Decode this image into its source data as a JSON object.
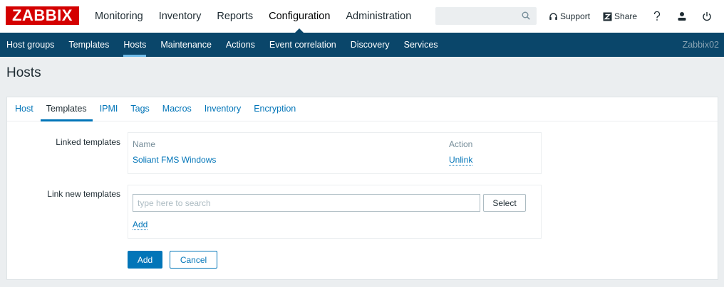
{
  "brand": {
    "logo_text": "ZABBIX",
    "color": "#d40000"
  },
  "main_menu": [
    {
      "label": "Monitoring"
    },
    {
      "label": "Inventory"
    },
    {
      "label": "Reports"
    },
    {
      "label": "Configuration",
      "active": true
    },
    {
      "label": "Administration"
    }
  ],
  "search": {
    "placeholder": "",
    "icon": "search-icon"
  },
  "top_actions": {
    "support_label": "Support",
    "share_label": "Share"
  },
  "sub_menu": [
    {
      "label": "Host groups"
    },
    {
      "label": "Templates"
    },
    {
      "label": "Hosts",
      "active": true
    },
    {
      "label": "Maintenance"
    },
    {
      "label": "Actions"
    },
    {
      "label": "Event correlation"
    },
    {
      "label": "Discovery"
    },
    {
      "label": "Services"
    }
  ],
  "server_name": "Zabbix02",
  "page_title": "Hosts",
  "tabs": [
    {
      "label": "Host"
    },
    {
      "label": "Templates",
      "active": true
    },
    {
      "label": "IPMI"
    },
    {
      "label": "Tags"
    },
    {
      "label": "Macros"
    },
    {
      "label": "Inventory"
    },
    {
      "label": "Encryption"
    }
  ],
  "linked_templates": {
    "label": "Linked templates",
    "col_name": "Name",
    "col_action": "Action",
    "rows": [
      {
        "name": "Soliant FMS Windows",
        "action": "Unlink"
      }
    ]
  },
  "link_new": {
    "label": "Link new templates",
    "input_placeholder": "type here to search",
    "select_label": "Select",
    "add_link_label": "Add"
  },
  "form_buttons": {
    "add_label": "Add",
    "cancel_label": "Cancel"
  },
  "colors": {
    "header_bg": "#0a466a",
    "link": "#0275b8",
    "page_bg": "#ebeef0"
  }
}
